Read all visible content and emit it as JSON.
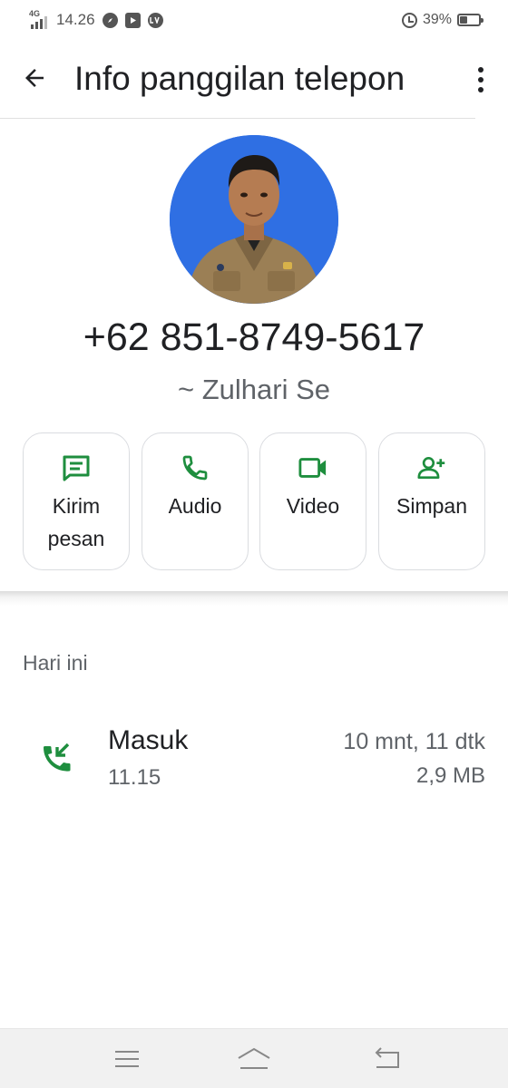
{
  "status_bar": {
    "network": "4G",
    "time": "14.26",
    "notification_icons": [
      "compass-icon",
      "youtube-icon",
      "lte-icon"
    ],
    "battery_percent": "39%",
    "battery_level": 0.39,
    "icons": [
      "signal-icon",
      "alarm-icon",
      "battery-icon"
    ]
  },
  "app_bar": {
    "title": "Info panggilan telepon",
    "back_icon": "arrow-left-icon",
    "menu_icon": "more-vert-icon"
  },
  "contact": {
    "avatar": "contact-photo",
    "phone_number": "+62 851-8749-5617",
    "alias": "~ Zulhari Se"
  },
  "actions": [
    {
      "label": "Kirim pesan",
      "icon": "message-icon"
    },
    {
      "label": "Audio",
      "icon": "phone-icon"
    },
    {
      "label": "Video",
      "icon": "video-camera-icon"
    },
    {
      "label": "Simpan",
      "icon": "add-person-icon"
    }
  ],
  "history": {
    "section_label": "Hari ini",
    "calls": [
      {
        "type": "Masuk",
        "time": "11.15",
        "duration": "10 mnt, 11 dtk",
        "size": "2,9 MB",
        "icon": "incoming-call-icon"
      }
    ]
  },
  "system_nav": [
    "menu-icon",
    "home-icon",
    "back-icon"
  ],
  "colors": {
    "accent_green": "#1e8e3e",
    "avatar_bg": "#2f6fe3",
    "text_primary": "#202124",
    "text_secondary": "#5f6368",
    "nav_bg": "#f1f1f1"
  }
}
